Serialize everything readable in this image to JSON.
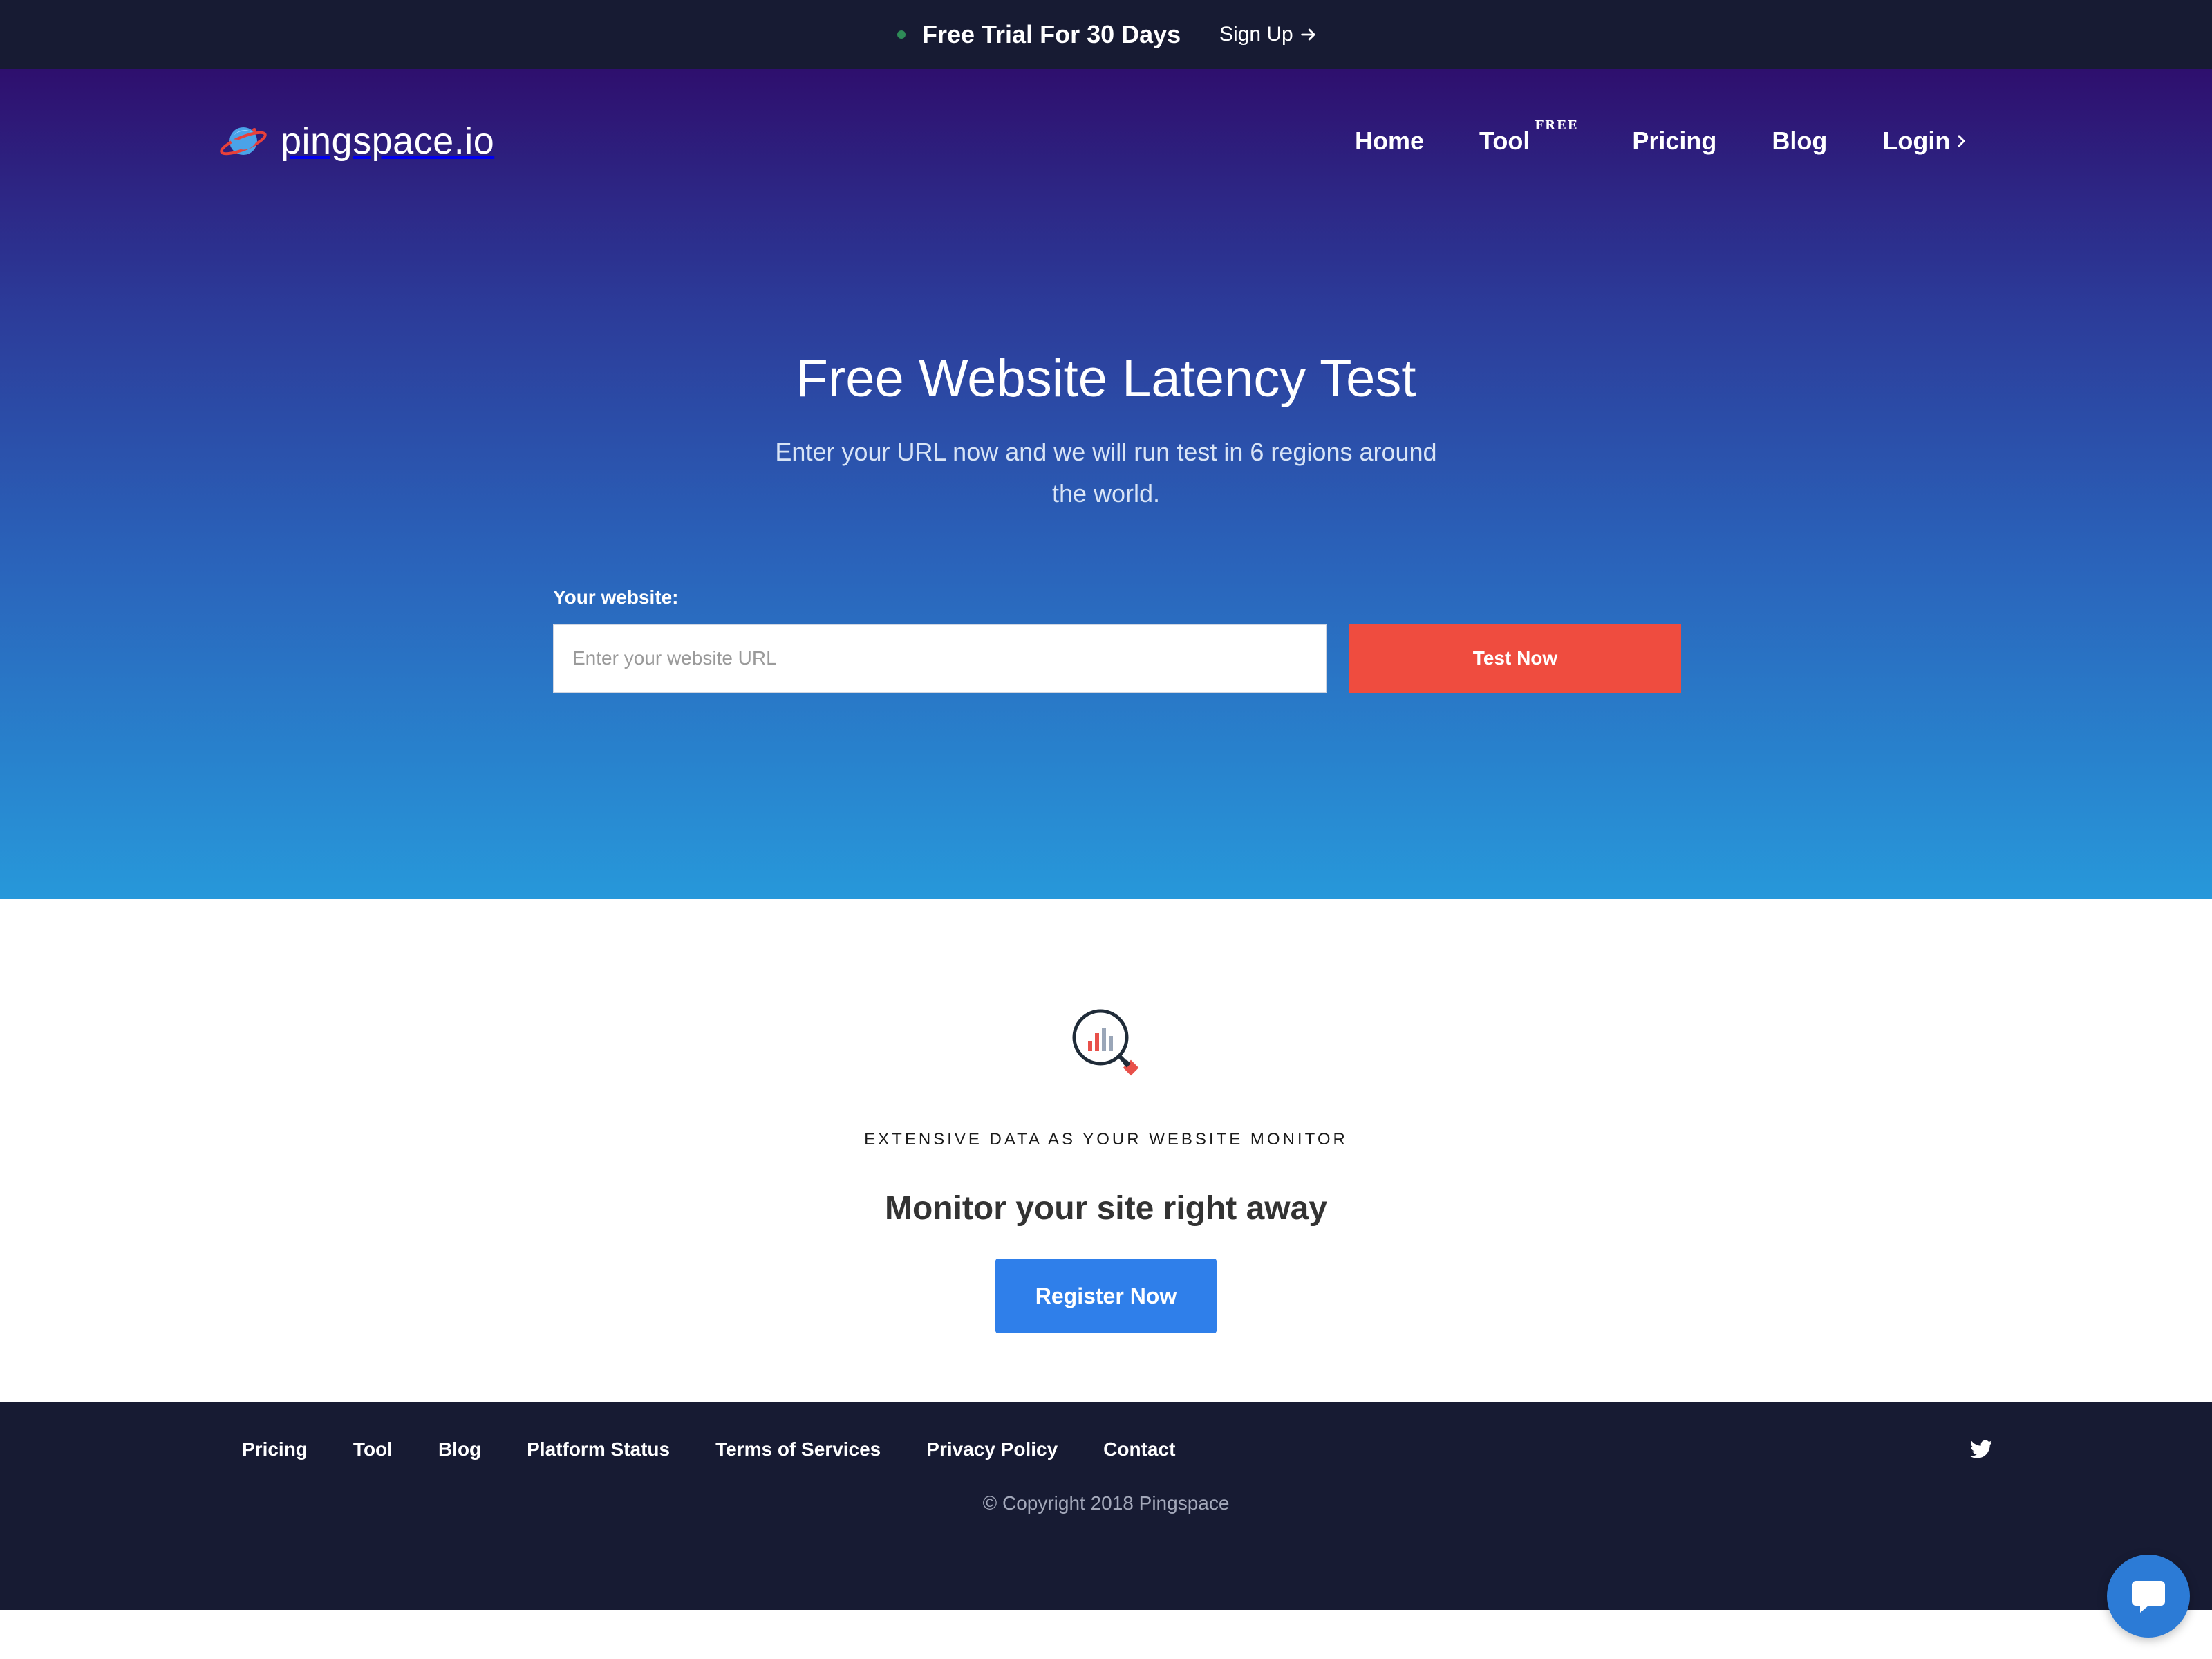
{
  "promo": {
    "text": "Free Trial For 30 Days",
    "link_label": "Sign Up",
    "dot_color": "#2e8b57"
  },
  "header": {
    "logo_text": "pingspace.io",
    "nav": {
      "home": "Home",
      "tool": "Tool",
      "tool_badge": "FREE",
      "pricing": "Pricing",
      "blog": "Blog",
      "login": "Login"
    }
  },
  "hero": {
    "title": "Free Website Latency Test",
    "subtitle": "Enter your URL now and we will run test in 6 regions around the world.",
    "field_label": "Your website:",
    "input_placeholder": "Enter your website URL",
    "button_label": "Test Now",
    "button_color": "#ef4c3f"
  },
  "monitor": {
    "icon": "magnifier-chart-icon",
    "kicker": "EXTENSIVE DATA AS YOUR WEBSITE MONITOR",
    "title": "Monitor your site right away",
    "button_label": "Register Now",
    "button_color": "#2f7fea"
  },
  "footer": {
    "links": [
      "Pricing",
      "Tool",
      "Blog",
      "Platform Status",
      "Terms of Services",
      "Privacy Policy",
      "Contact"
    ],
    "social_icon": "twitter-icon",
    "copyright": "© Copyright 2018 Pingspace"
  },
  "chat": {
    "icon": "chat-bubble-icon"
  }
}
